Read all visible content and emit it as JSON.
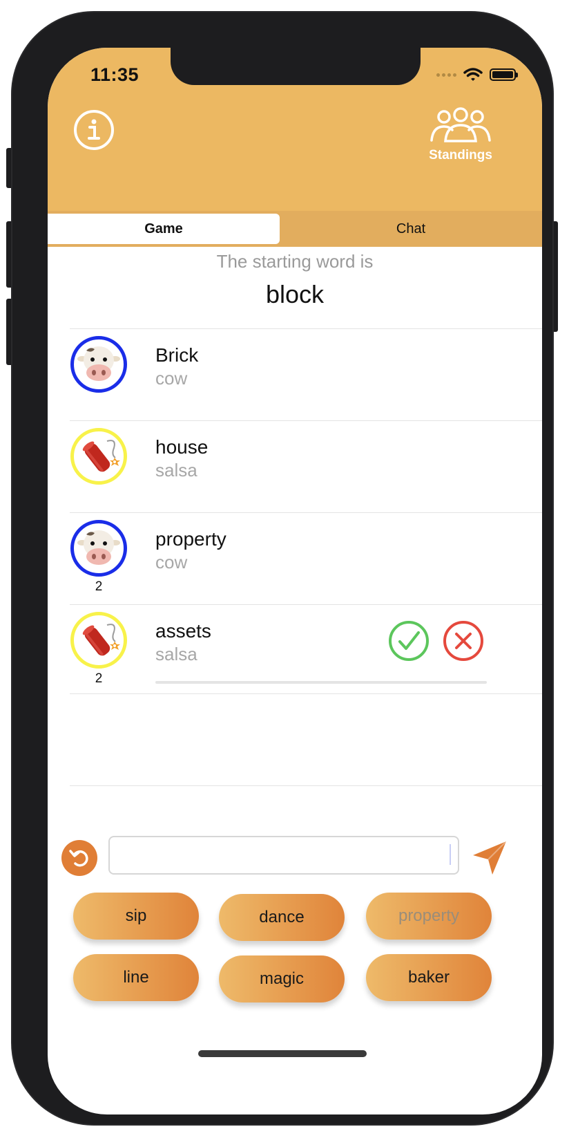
{
  "status_bar": {
    "time": "11:35"
  },
  "header": {
    "standings_label": "Standings"
  },
  "tabs": [
    {
      "label": "Game"
    },
    {
      "label": "Chat"
    }
  ],
  "starting": {
    "caption": "The starting word is",
    "word": "block"
  },
  "entries": [
    {
      "word": "Brick",
      "team": "cow",
      "avatar": "cow-emoji",
      "ring_color": "#1a2de8",
      "count": ""
    },
    {
      "word": "house",
      "team": "salsa",
      "avatar": "firecracker-emoji",
      "ring_color": "#f8f24a",
      "count": ""
    },
    {
      "word": "property",
      "team": "cow",
      "avatar": "cow-emoji",
      "ring_color": "#1a2de8",
      "count": "2"
    },
    {
      "word": "assets",
      "team": "salsa",
      "avatar": "firecracker-emoji",
      "ring_color": "#f8f24a",
      "count": "2"
    }
  ],
  "vote": {
    "accept_color": "#5cc65c",
    "reject_color": "#e5493d"
  },
  "input": {
    "value": "",
    "placeholder": ""
  },
  "word_chips": [
    {
      "label": "sip",
      "used": false
    },
    {
      "label": "dance",
      "used": false
    },
    {
      "label": "property",
      "used": true
    },
    {
      "label": "line",
      "used": false
    },
    {
      "label": "magic",
      "used": false
    },
    {
      "label": "baker",
      "used": false
    }
  ],
  "colors": {
    "header": "#ecb862",
    "accent": "#e07e36"
  }
}
